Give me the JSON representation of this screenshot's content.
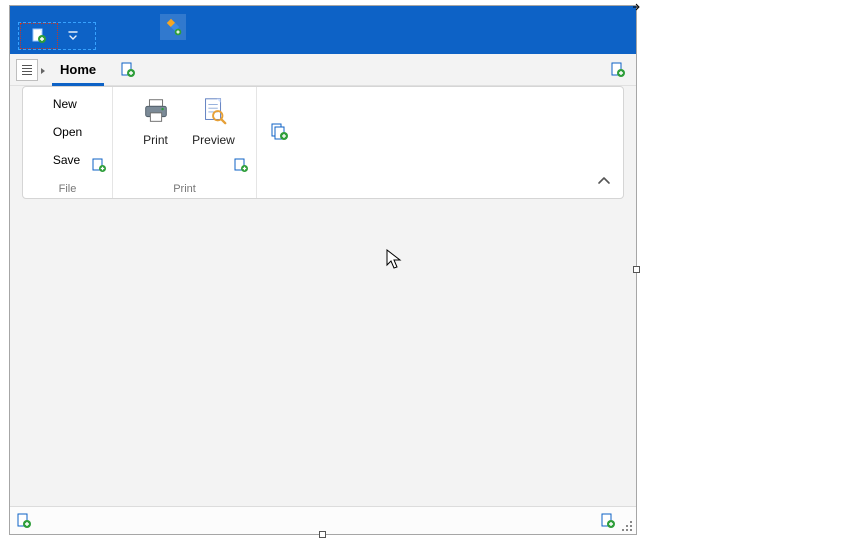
{
  "tabs": {
    "home": "Home"
  },
  "file_group": {
    "caption": "File",
    "items": [
      "New",
      "Open",
      "Save"
    ]
  },
  "print_group": {
    "caption": "Print",
    "print_label": "Print",
    "preview_label": "Preview"
  }
}
